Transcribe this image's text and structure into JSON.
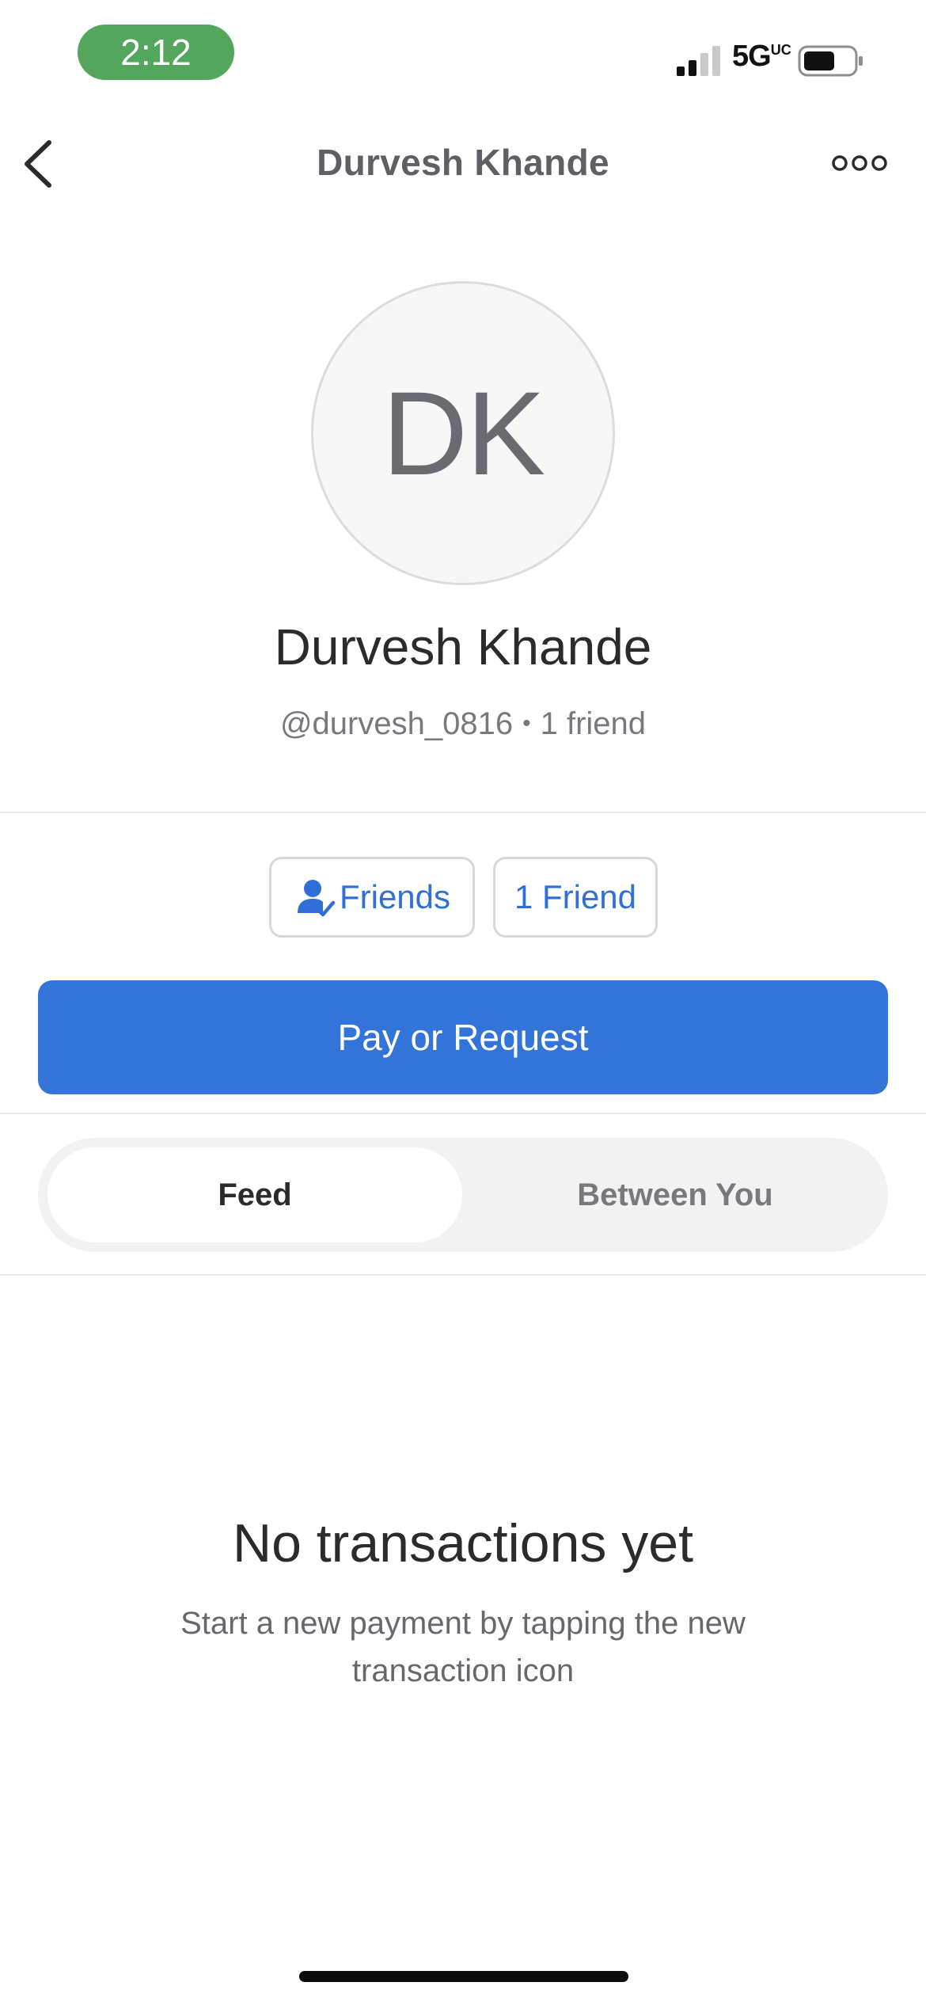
{
  "status_bar": {
    "time": "2:12",
    "network": "5G",
    "network_suffix": "UC"
  },
  "nav": {
    "title": "Durvesh Khande"
  },
  "profile": {
    "initials": "DK",
    "name": "Durvesh Khande",
    "username": "@durvesh_0816",
    "friend_count_text": "1 friend"
  },
  "actions": {
    "friends_label": "Friends",
    "friend_count_label": "1 Friend",
    "pay_label": "Pay or Request"
  },
  "tabs": {
    "items": [
      {
        "label": "Feed",
        "selected": true
      },
      {
        "label": "Between You",
        "selected": false
      }
    ]
  },
  "empty_state": {
    "title": "No transactions yet",
    "subtitle": "Start a new payment by tapping the new transaction icon"
  },
  "colors": {
    "accent": "#3374d8",
    "status_pill": "#55a65d",
    "link_blue": "#2f6fd6"
  },
  "icons": {
    "back": "chevron-left-icon",
    "more": "more-horizontal-icon",
    "friend": "user-check-icon"
  }
}
